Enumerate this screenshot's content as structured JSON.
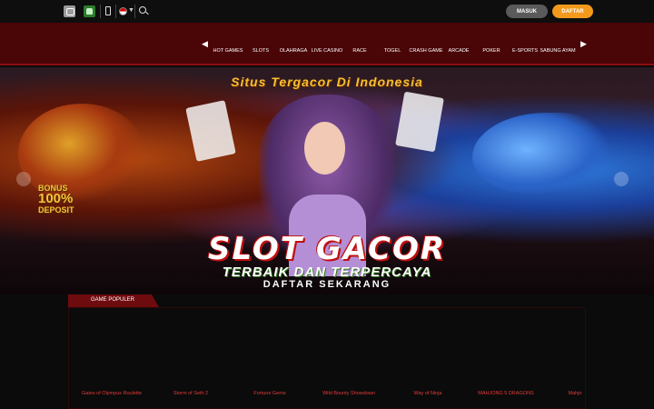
{
  "topbar": {
    "login_label": "MASUK",
    "register_label": "DAFTAR"
  },
  "nav": {
    "items": [
      "HOT GAMES",
      "SLOTS",
      "OLAHRAGA",
      "LIVE CASINO",
      "RACE",
      "TOGEL",
      "CRASH GAME",
      "ARCADE",
      "POKER",
      "E-SPORTS",
      "SABUNG AYAM"
    ]
  },
  "banner": {
    "headline": "Situs Tergacor Di Indonesia",
    "bonus_line1": "BONUS",
    "bonus_line2": "100%",
    "bonus_line3": "DEPOSIT",
    "title": "SLOT GACOR",
    "subtitle": "TERBAIK DAN TERPERCAYA",
    "cta": "DAFTAR SEKARANG"
  },
  "games": {
    "section_title": "GAME POPULER",
    "items": [
      "Gates of Olympus Roulette",
      "Storm of Seth 2",
      "Fortune Gems",
      "Wild Bounty Showdown",
      "Way of Ninja",
      "MAHJONG 5 DRAGONS",
      "Mahjo"
    ]
  },
  "colors": {
    "nav_bg": "#4a0507",
    "accent_orange": "#f39a1c",
    "accent_red": "#6e0b0e",
    "game_name": "#e23b3b"
  }
}
